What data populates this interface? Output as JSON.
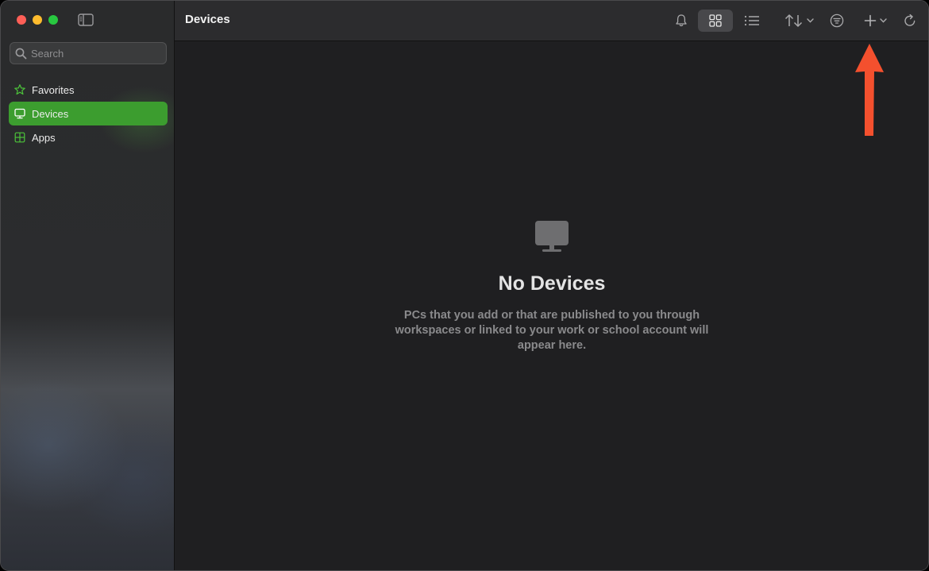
{
  "window": {
    "traffic_lights": [
      "close",
      "minimize",
      "zoom"
    ],
    "colors": {
      "close": "#fe5f57",
      "minimize": "#febc2e",
      "zoom": "#28c840"
    }
  },
  "sidebar": {
    "toggle_icon": "sidebar-toggle-icon",
    "search": {
      "placeholder": "Search",
      "value": ""
    },
    "items": [
      {
        "label": "Favorites",
        "icon": "star-icon",
        "active": false
      },
      {
        "label": "Devices",
        "icon": "monitor-icon",
        "active": true
      },
      {
        "label": "Apps",
        "icon": "apps-grid-icon",
        "active": false
      }
    ],
    "accent_color": "#3c9d2f"
  },
  "header": {
    "title": "Devices",
    "toolbar": [
      {
        "name": "notifications",
        "icon": "bell-icon"
      },
      {
        "name": "grid-view",
        "icon": "grid-icon",
        "selected": true
      },
      {
        "name": "list-view",
        "icon": "list-icon"
      },
      {
        "name": "sort",
        "icon": "sort-arrows-icon",
        "has_menu": true
      },
      {
        "name": "filter",
        "icon": "filter-icon"
      },
      {
        "name": "add",
        "icon": "plus-icon",
        "has_menu": true
      },
      {
        "name": "refresh",
        "icon": "refresh-icon"
      }
    ]
  },
  "annotation": {
    "icon": "red-arrow-icon",
    "color": "#f4502e",
    "points_to": "add"
  },
  "main": {
    "empty_state": {
      "icon": "monitor-icon",
      "title": "No Devices",
      "description": "PCs that you add or that are published to you through workspaces or linked to your work or school account will appear here."
    }
  }
}
